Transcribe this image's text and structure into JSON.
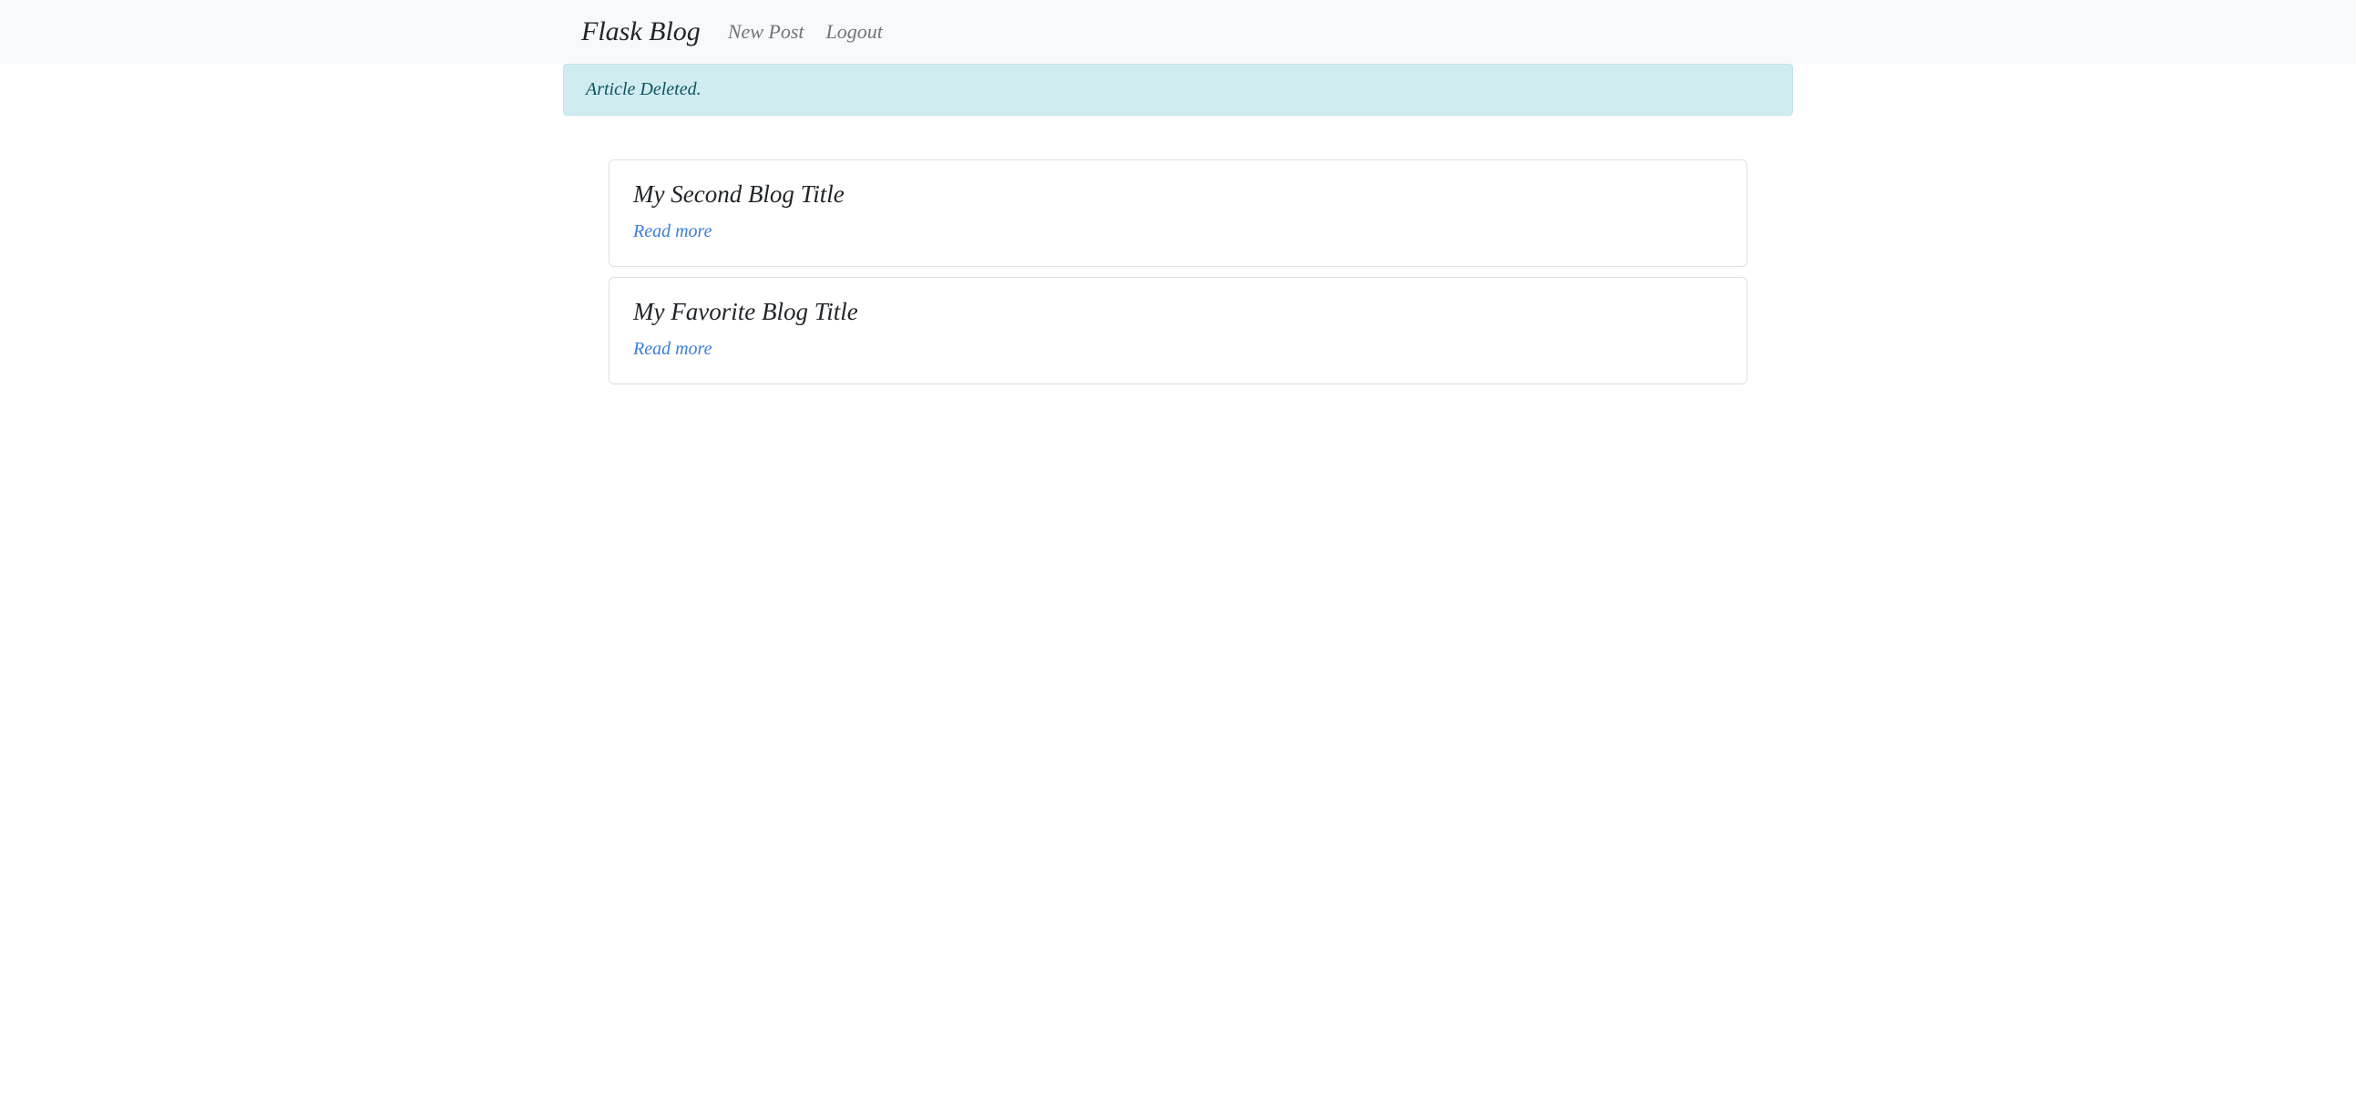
{
  "navbar": {
    "brand": "Flask Blog",
    "links": [
      {
        "label": "New Post"
      },
      {
        "label": "Logout"
      }
    ]
  },
  "alert": {
    "message": "Article Deleted."
  },
  "posts": [
    {
      "title": "My Second Blog Title",
      "read_more": "Read more"
    },
    {
      "title": "My Favorite Blog Title",
      "read_more": "Read more"
    }
  ]
}
